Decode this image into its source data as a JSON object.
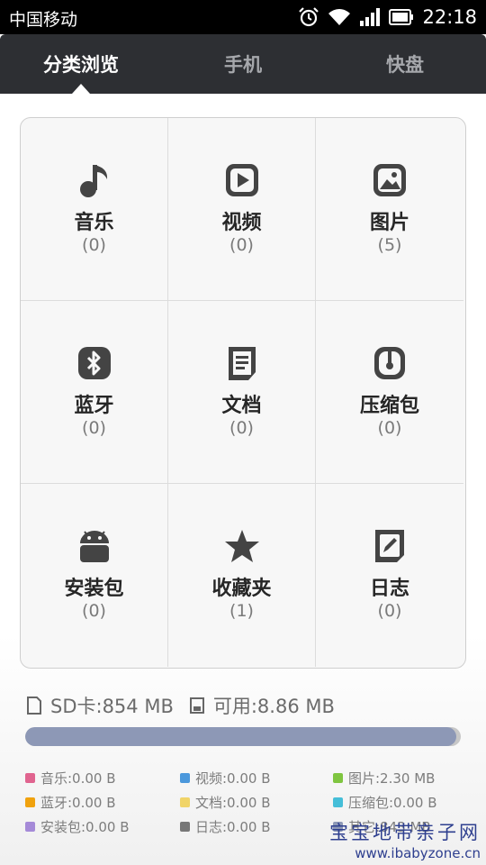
{
  "status_bar": {
    "carrier": "中国移动",
    "time": "22:18",
    "icons": [
      "alarm-icon",
      "wifi-icon",
      "signal-icon",
      "battery-icon"
    ]
  },
  "tabs": [
    {
      "label": "分类浏览",
      "active": true
    },
    {
      "label": "手机",
      "active": false
    },
    {
      "label": "快盘",
      "active": false
    }
  ],
  "categories": [
    {
      "label": "音乐",
      "count": "(0)",
      "icon": "music-note-icon"
    },
    {
      "label": "视频",
      "count": "(0)",
      "icon": "video-play-icon"
    },
    {
      "label": "图片",
      "count": "(5)",
      "icon": "picture-icon"
    },
    {
      "label": "蓝牙",
      "count": "(0)",
      "icon": "bluetooth-icon"
    },
    {
      "label": "文档",
      "count": "(0)",
      "icon": "document-icon"
    },
    {
      "label": "压缩包",
      "count": "(0)",
      "icon": "archive-icon"
    },
    {
      "label": "安装包",
      "count": "(0)",
      "icon": "android-icon"
    },
    {
      "label": "收藏夹",
      "count": "(1)",
      "icon": "star-icon"
    },
    {
      "label": "日志",
      "count": "(0)",
      "icon": "edit-log-icon"
    }
  ],
  "storage": {
    "sd_label": "SD卡:854 MB",
    "available_label": "可用:8.86 MB",
    "used_fraction": 0.99,
    "colors": {
      "used": "#8d98b6",
      "free": "#c7c7c7"
    }
  },
  "legend": [
    {
      "label": "音乐:0.00 B",
      "color": "#e0648f"
    },
    {
      "label": "视频:0.00 B",
      "color": "#4b98dc"
    },
    {
      "label": "图片:2.30 MB",
      "color": "#7fc540"
    },
    {
      "label": "蓝牙:0.00 B",
      "color": "#f0a20e"
    },
    {
      "label": "文档:0.00 B",
      "color": "#f0d468"
    },
    {
      "label": "压缩包:0.00 B",
      "color": "#45bed8"
    },
    {
      "label": "安装包:0.00 B",
      "color": "#a58ad8"
    },
    {
      "label": "日志:0.00 B",
      "color": "#777777"
    },
    {
      "label": "其它:843 MB",
      "color": "#8d98b6"
    }
  ],
  "watermark": {
    "line1": "宝宝地带亲子网",
    "line2": "www.ibabyzone.cn"
  }
}
